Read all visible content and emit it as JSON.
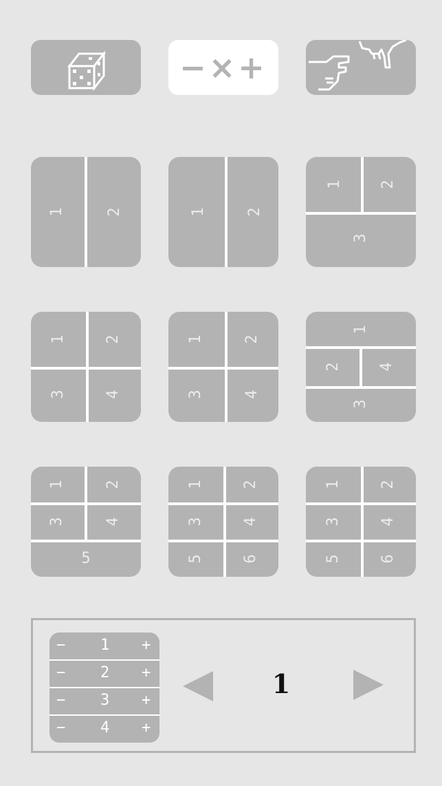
{
  "toolbar": {
    "dice_icon": "dice-icon",
    "counter_toggle_label": "−×+",
    "hand_icon": "pointing-hands-icon"
  },
  "layouts": [
    {
      "name": "two-vertical-a",
      "labels": [
        "1",
        "2"
      ]
    },
    {
      "name": "two-vertical-b",
      "labels": [
        "1",
        "2"
      ]
    },
    {
      "name": "three-top-two-bottom-one",
      "labels": [
        "1",
        "2",
        "3"
      ]
    },
    {
      "name": "four-grid-a",
      "labels": [
        "1",
        "2",
        "3",
        "4"
      ]
    },
    {
      "name": "four-grid-b",
      "labels": [
        "1",
        "2",
        "3",
        "4"
      ]
    },
    {
      "name": "four-cross",
      "labels": [
        "1",
        "2",
        "4",
        "3"
      ]
    },
    {
      "name": "five",
      "labels": [
        "1",
        "2",
        "3",
        "4",
        "5"
      ]
    },
    {
      "name": "six-a",
      "labels": [
        "1",
        "2",
        "3",
        "4",
        "5",
        "6"
      ]
    },
    {
      "name": "six-b",
      "labels": [
        "1",
        "2",
        "3",
        "4",
        "5",
        "6"
      ]
    }
  ],
  "counter": {
    "rows": [
      {
        "minus": "−",
        "label": "1",
        "plus": "+"
      },
      {
        "minus": "−",
        "label": "2",
        "plus": "+"
      },
      {
        "minus": "−",
        "label": "3",
        "plus": "+"
      },
      {
        "minus": "−",
        "label": "4",
        "plus": "+"
      }
    ],
    "page": "1"
  },
  "colors": {
    "background": "#e6e6e6",
    "tile": "#b3b3b3",
    "divider": "#ffffff",
    "active_button": "#ffffff",
    "page_number": "#111111"
  }
}
